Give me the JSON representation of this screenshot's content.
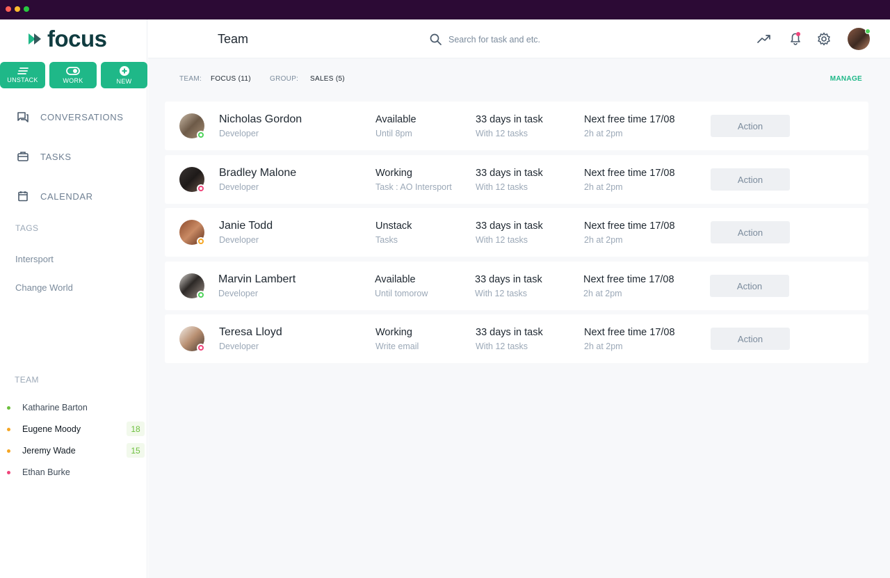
{
  "window": {
    "controls": [
      "close",
      "minimize",
      "maximize"
    ],
    "control_colors": [
      "#ff5f57",
      "#febc2e",
      "#28c840"
    ]
  },
  "sidebar": {
    "logo_text": "focus",
    "quick_actions": [
      {
        "label": "UNSTACK",
        "icon": "stack-lines-icon"
      },
      {
        "label": "WORK",
        "icon": "toggle-icon"
      },
      {
        "label": "NEW",
        "icon": "plus-circle-icon"
      }
    ],
    "nav": [
      {
        "label": "CONVERSATIONS",
        "icon": "chat-icon"
      },
      {
        "label": "TASKS",
        "icon": "briefcase-icon"
      },
      {
        "label": "CALENDAR",
        "icon": "calendar-icon"
      }
    ],
    "tags_title": "TAGS",
    "tags": [
      "Intersport",
      "Change World"
    ],
    "team_title": "TEAM",
    "team": [
      {
        "name": "Katharine Barton",
        "status_color": "#6cbf3c",
        "badge": ""
      },
      {
        "name": "Eugene Moody",
        "status_color": "#f5a623",
        "badge": "18"
      },
      {
        "name": "Jeremy Wade",
        "status_color": "#f5a623",
        "badge": "15"
      },
      {
        "name": "Ethan Burke",
        "status_color": "#f0447a",
        "badge": ""
      }
    ]
  },
  "header": {
    "title": "Team",
    "search_placeholder": "Search for task and etc.",
    "icons": [
      "trend-icon",
      "bell-icon",
      "gear-icon",
      "avatar"
    ]
  },
  "filters": {
    "team_key": "TEAM:",
    "team_value": "FOCUS (11)",
    "group_key": "GROUP:",
    "group_value": "SALES (5)",
    "manage": "MANAGE"
  },
  "members": [
    {
      "name": "Nicholas Gordon",
      "role": "Developer",
      "status": "Available",
      "status_detail": "Until 8pm",
      "days": "33 days in task",
      "tasks": "With 12 tasks",
      "next_free": "Next free time 17/08",
      "next_detail": "2h at 2pm",
      "action": "Action",
      "status_color": "#4fd35b"
    },
    {
      "name": "Bradley Malone",
      "role": "Developer",
      "status": "Working",
      "status_detail": "Task : AO Intersport",
      "days": "33 days in task",
      "tasks": "With 12 tasks",
      "next_free": "Next free time 17/08",
      "next_detail": "2h at 2pm",
      "action": "Action",
      "status_color": "#f0447a"
    },
    {
      "name": "Janie Todd",
      "role": "Developer",
      "status": "Unstack",
      "status_detail": "Tasks",
      "days": "33 days in task",
      "tasks": "With 12 tasks",
      "next_free": "Next free time 17/08",
      "next_detail": "2h at 2pm",
      "action": "Action",
      "status_color": "#f5a623"
    },
    {
      "name": "Marvin Lambert",
      "role": "Developer",
      "status": "Available",
      "status_detail": "Until tomorow",
      "days": "33 days in task",
      "tasks": "With 12 tasks",
      "next_free": "Next free time 17/08",
      "next_detail": "2h at 2pm",
      "action": "Action",
      "status_color": "#4fd35b"
    },
    {
      "name": "Teresa Lloyd",
      "role": "Developer",
      "status": "Working",
      "status_detail": "Write email",
      "days": "33 days in task",
      "tasks": "With 12 tasks",
      "next_free": "Next free time 17/08",
      "next_detail": "2h at 2pm",
      "action": "Action",
      "status_color": "#f0447a"
    }
  ]
}
